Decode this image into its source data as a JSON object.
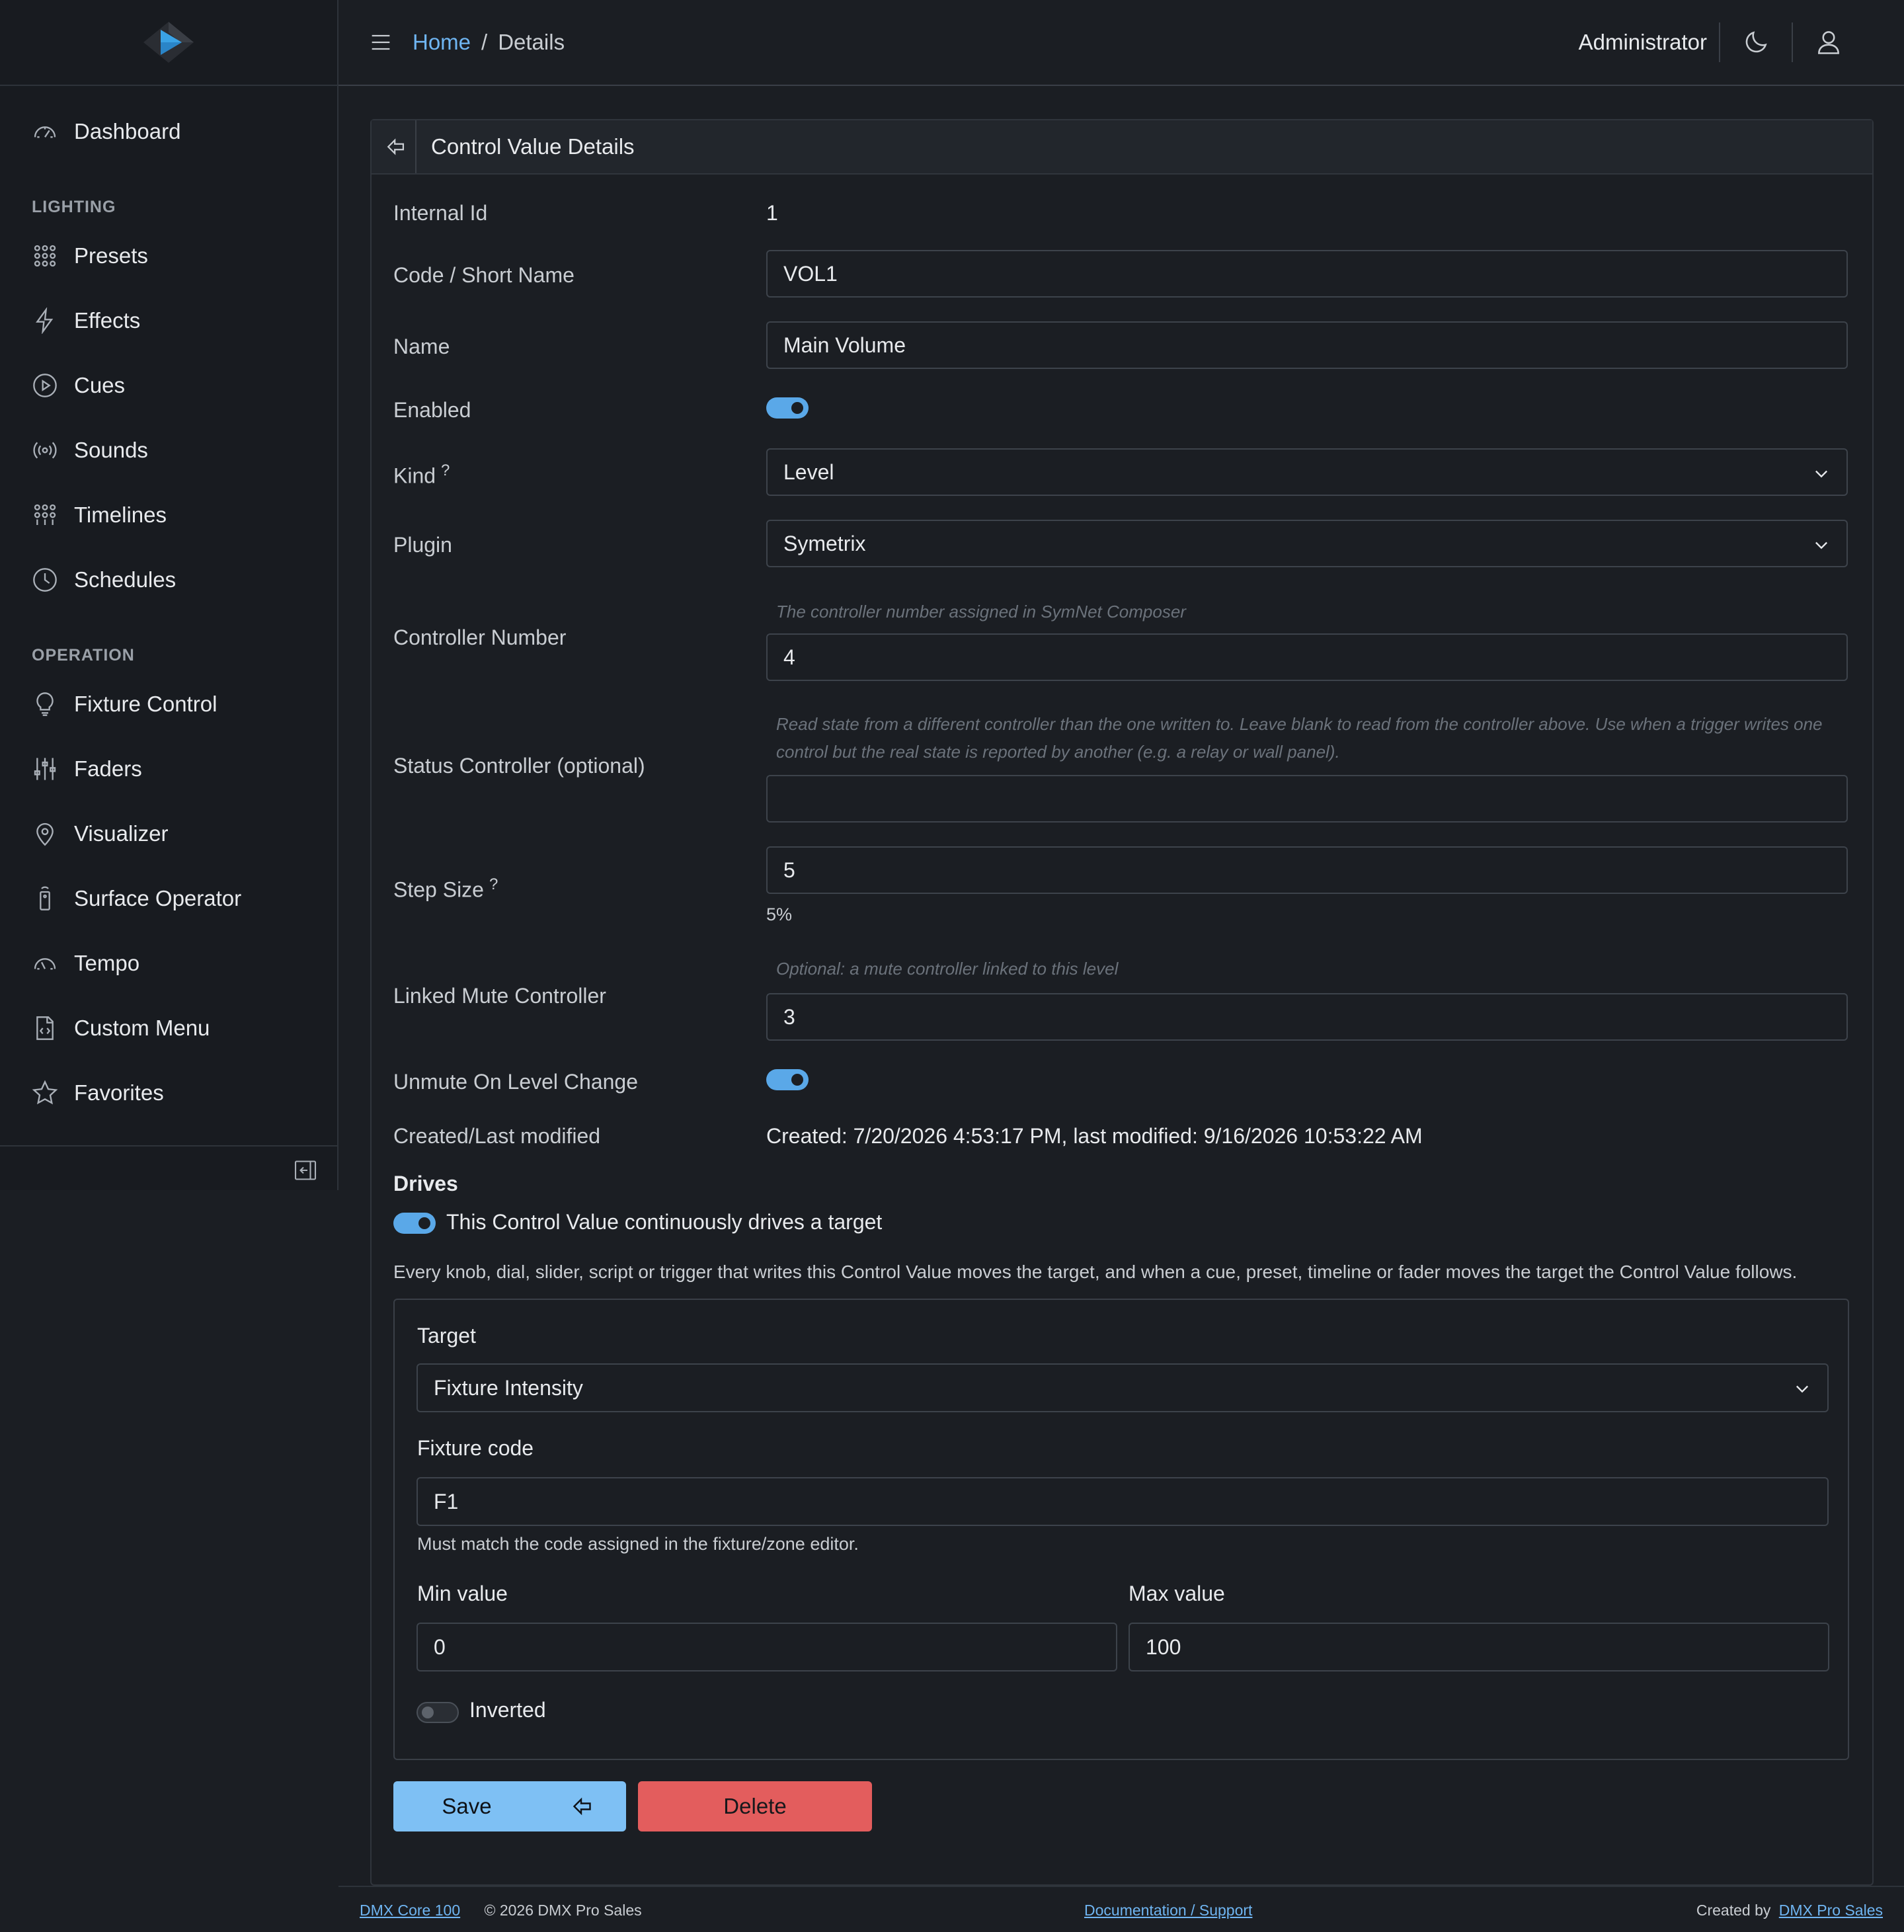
{
  "header": {
    "breadcrumb_home": "Home",
    "breadcrumb_sep": "/",
    "breadcrumb_current": "Details",
    "user": "Administrator"
  },
  "sidebar": {
    "dashboard": "Dashboard",
    "section_lighting": "LIGHTING",
    "lighting_items": [
      "Presets",
      "Effects",
      "Cues",
      "Sounds",
      "Timelines",
      "Schedules"
    ],
    "section_operation": "OPERATION",
    "operation_items": [
      "Fixture Control",
      "Faders",
      "Visualizer",
      "Surface Operator",
      "Tempo",
      "Custom Menu",
      "Favorites"
    ]
  },
  "card": {
    "title": "Control Value Details"
  },
  "form": {
    "internal_id_label": "Internal Id",
    "internal_id": "1",
    "code_label": "Code / Short Name",
    "code": "VOL1",
    "name_label": "Name",
    "name": "Main Volume",
    "enabled_label": "Enabled",
    "enabled": true,
    "kind_label": "Kind",
    "kind": "Level",
    "help_mark": "?",
    "plugin_label": "Plugin",
    "plugin": "Symetrix",
    "controller_label": "Controller Number",
    "controller_hint": "The controller number assigned in SymNet Composer",
    "controller": "4",
    "status_label": "Status Controller (optional)",
    "status_hint": "Read state from a different controller than the one written to. Leave blank to read from the controller above. Use when a trigger writes one control but the real state is reported by another (e.g. a relay or wall panel).",
    "status_value": "",
    "step_label": "Step Size",
    "step": "5",
    "step_percent": "5%",
    "mute_label": "Linked Mute Controller",
    "mute_hint": "Optional: a mute controller linked to this level",
    "mute": "3",
    "unmute_label": "Unmute On Level Change",
    "unmute": true,
    "modified_label": "Created/Last modified",
    "modified": "Created: 7/20/2026 4:53:17 PM, last modified: 9/16/2026 10:53:22 AM"
  },
  "drives": {
    "title": "Drives",
    "toggle_label": "This Control Value continuously drives a target",
    "toggle": true,
    "description": "Every knob, dial, slider, script or trigger that writes this Control Value moves the target, and when a cue, preset, timeline or fader moves the target the Control Value follows.",
    "target_label": "Target",
    "target": "Fixture Intensity",
    "fixture_code_label": "Fixture code",
    "fixture_code": "F1",
    "fixture_code_hint": "Must match the code assigned in the fixture/zone editor.",
    "min_label": "Min value",
    "min": "0",
    "max_label": "Max value",
    "max": "100",
    "inverted_label": "Inverted",
    "inverted": false
  },
  "buttons": {
    "save": "Save",
    "delete": "Delete"
  },
  "footer": {
    "product": "DMX Core 100",
    "copyright": "© 2026 DMX Pro Sales",
    "docs": "Documentation / Support",
    "created_by": "Created by",
    "company": "DMX Pro Sales"
  },
  "colors": {
    "accent": "#6fb5f2",
    "toggle_on": "#5aa8e8",
    "save": "#7ec0f4",
    "delete": "#e35d5d",
    "background": "#1b1e23"
  }
}
